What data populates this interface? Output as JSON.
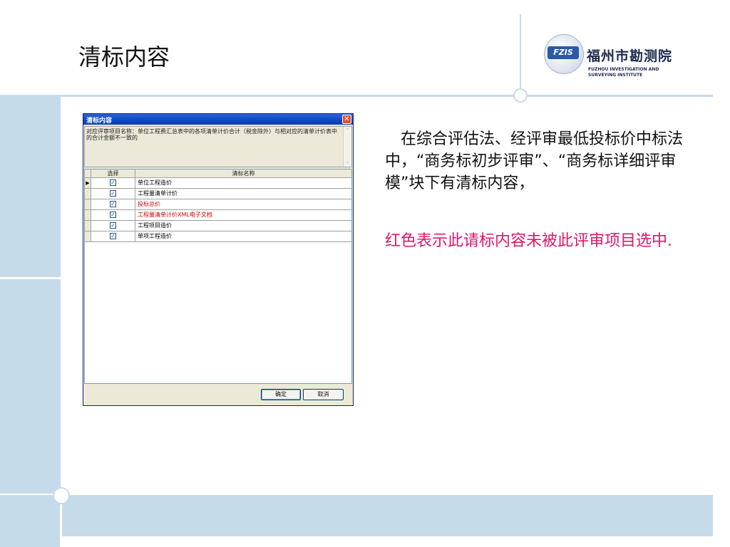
{
  "slide": {
    "title": "清标内容",
    "paragraph": "　在综合评估法、经评审最低投标价中标法中，“商务标初步评审”、“商务标详细评审模”块下有清标内容，",
    "paragraph_red": "红色表示此请标内容未被此评审项目选中."
  },
  "logo": {
    "badge": "FZIS",
    "name_cn": "福州市勘测院",
    "name_en_line1": "FUZHOU INVESTIGATION AND",
    "name_en_line2": "SURVEYING INSTITUTE"
  },
  "dialog": {
    "title": "清标内容",
    "close_glyph": "✕",
    "description": "对应评审项目名称：单位工程费汇总表中的各项清单计价合计（税金除外）与相对应的清单计价表中的合计金额不一致的",
    "columns": {
      "select": "选择",
      "name": "清标名称"
    },
    "rows": [
      {
        "name": "单位工程造价",
        "checked": true,
        "red": false,
        "current": true
      },
      {
        "name": "工程量清单计价",
        "checked": true,
        "red": false,
        "current": false
      },
      {
        "name": "投标总价",
        "checked": true,
        "red": true,
        "current": false
      },
      {
        "name": "工程量清单计价XML电子文档",
        "checked": true,
        "red": true,
        "current": false
      },
      {
        "name": "工程项目造价",
        "checked": true,
        "red": false,
        "current": false
      },
      {
        "name": "单项工程造价",
        "checked": true,
        "red": false,
        "current": false
      }
    ],
    "ok_label": "确定",
    "cancel_label": "取消"
  },
  "colors": {
    "red_item": "#d40000",
    "red_text": "#e0166a",
    "band": "#c6dbea"
  }
}
